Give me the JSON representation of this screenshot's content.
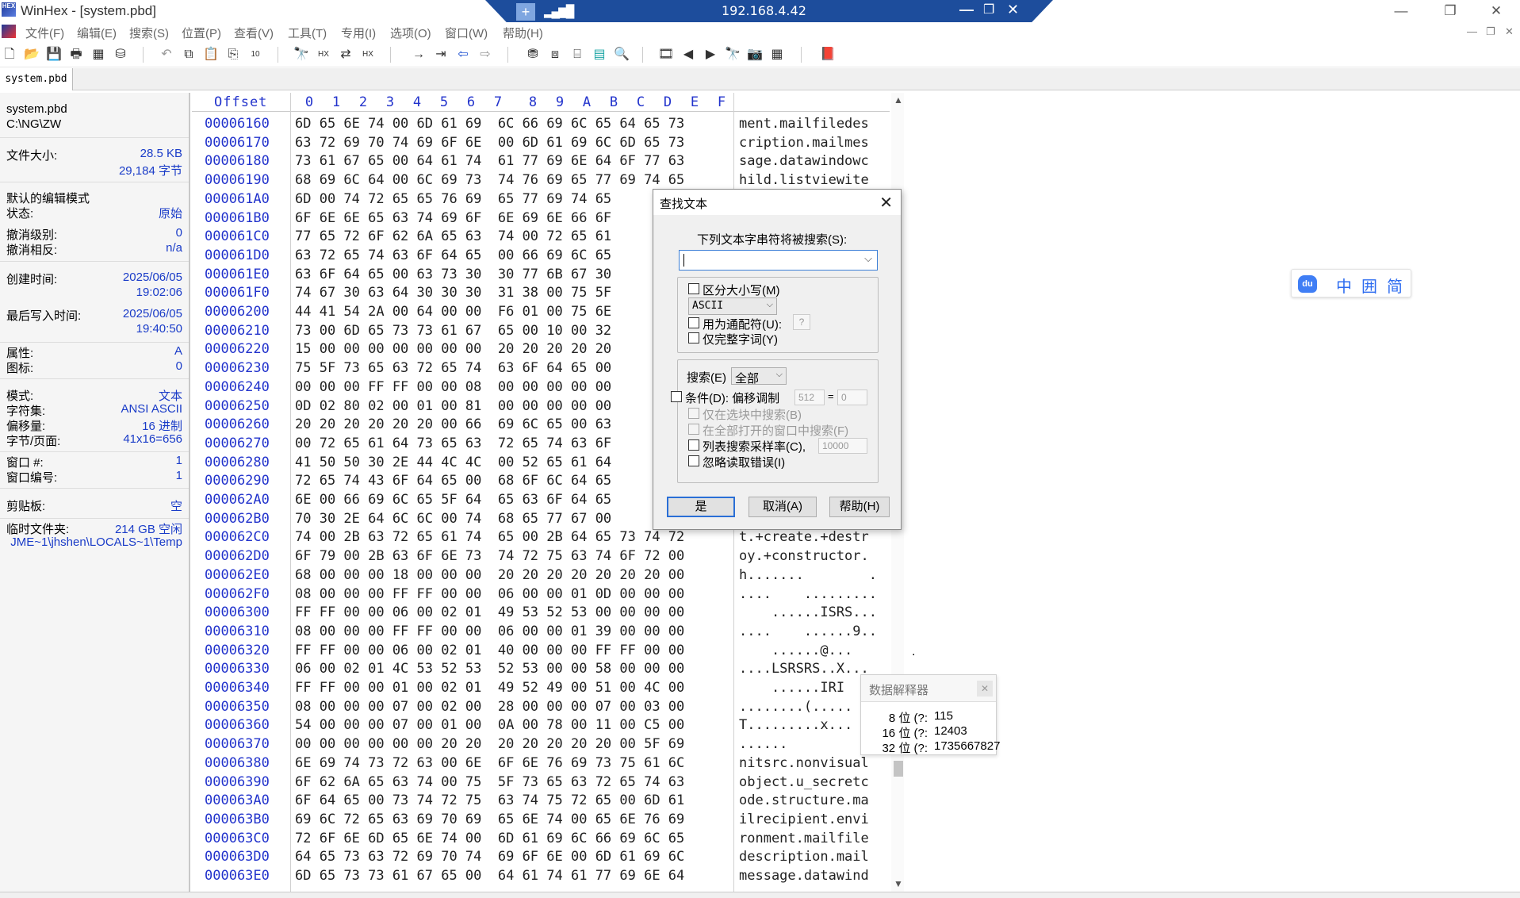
{
  "window": {
    "title": "WinHex - [system.pbd]"
  },
  "remote_bar": {
    "ip": "192.168.4.42"
  },
  "menu": {
    "items": [
      "文件(F)",
      "编辑(E)",
      "搜索(S)",
      "位置(P)",
      "查看(V)",
      "工具(T)",
      "专用(I)",
      "选项(O)",
      "窗口(W)",
      "帮助(H)"
    ]
  },
  "tab": {
    "name": "system.pbd"
  },
  "info": {
    "file_name": "system.pbd",
    "path": "C:\\NG\\ZW",
    "size_label": "文件大小:",
    "size_kb": "28.5 KB",
    "size_bytes": "29,184 字节",
    "edit_mode_label": "默认的编辑模式",
    "state_label": "状态:",
    "state_value": "原始",
    "undo_level_label": "撤消级别:",
    "undo_level_value": "0",
    "undo_reverse_label": "撤消相反:",
    "undo_reverse_value": "n/a",
    "created_label": "创建时间:",
    "created_date": "2025/06/05",
    "created_time": "19:02:06",
    "modified_label": "最后写入时间:",
    "modified_date": "2025/06/05",
    "modified_time": "19:40:50",
    "attr_label": "属性:",
    "attr_value": "A",
    "icon_label": "图标:",
    "icon_value": "0",
    "mode_label": "模式:",
    "mode_value": "文本",
    "charset_label": "字符集:",
    "charset_value": "ANSI ASCII",
    "offset_label": "偏移量:",
    "offset_value": "16 进制",
    "bpp_label": "字节/页面:",
    "bpp_value": "41x16=656",
    "window_num_label": "窗口 #:",
    "window_num_value": "1",
    "window_id_label": "窗口编号:",
    "window_id_value": "1",
    "clipboard_label": "剪贴板:",
    "clipboard_value": "空",
    "temp_label": "临时文件夹:",
    "temp_free": "214 GB 空闲",
    "temp_path": "JME~1\\jhshen\\LOCALS~1\\Temp"
  },
  "hex": {
    "offset_header": "Offset",
    "columns": [
      "0",
      "1",
      "2",
      "3",
      "4",
      "5",
      "6",
      "7",
      "8",
      "9",
      "A",
      "B",
      "C",
      "D",
      "E",
      "F"
    ],
    "rows": [
      {
        "offset": "00006160",
        "bytes": "6D 65 6E 74 00 6D 61 69  6C 66 69 6C 65 64 65 73",
        "text": "ment.mailfiledes"
      },
      {
        "offset": "00006170",
        "bytes": "63 72 69 70 74 69 6F 6E  00 6D 61 69 6C 6D 65 73",
        "text": "cription.mailmes"
      },
      {
        "offset": "00006180",
        "bytes": "73 61 67 65 00 64 61 74  61 77 69 6E 64 6F 77 63",
        "text": "sage.datawindowc"
      },
      {
        "offset": "00006190",
        "bytes": "68 69 6C 64 00 6C 69 73  74 76 69 65 77 69 74 65",
        "text": "hild.listviewite"
      },
      {
        "offset": "000061A0",
        "bytes": "6D 00 74 72 65 65 76 69  65 77 69 74 65",
        "text": ""
      },
      {
        "offset": "000061B0",
        "bytes": "6F 6E 6E 65 63 74 69 6F  6E 69 6E 66 6F",
        "text": ""
      },
      {
        "offset": "000061C0",
        "bytes": "77 65 72 6F 62 6A 65 63  74 00 72 65 61",
        "text": ""
      },
      {
        "offset": "000061D0",
        "bytes": "63 72 65 74 63 6F 64 65  00 66 69 6C 65",
        "text": ""
      },
      {
        "offset": "000061E0",
        "bytes": "63 6F 64 65 00 63 73 30  30 77 6B 67 30",
        "text": ""
      },
      {
        "offset": "000061F0",
        "bytes": "74 67 30 63 64 30 30 30  31 38 00 75 5F",
        "text": ""
      },
      {
        "offset": "00006200",
        "bytes": "44 41 54 2A 00 64 00 00  F6 01 00 75 6E",
        "text": ""
      },
      {
        "offset": "00006210",
        "bytes": "73 00 6D 65 73 73 61 67  65 00 10 00 32",
        "text": ""
      },
      {
        "offset": "00006220",
        "bytes": "15 00 00 00 00 00 00 00  20 20 20 20 20",
        "text": ""
      },
      {
        "offset": "00006230",
        "bytes": "75 5F 73 65 63 72 65 74  63 6F 64 65 00",
        "text": ""
      },
      {
        "offset": "00006240",
        "bytes": "00 00 00 FF FF 00 00 08  00 00 00 00 00",
        "text": ""
      },
      {
        "offset": "00006250",
        "bytes": "0D 02 80 02 00 01 00 81  00 00 00 00 00",
        "text": ""
      },
      {
        "offset": "00006260",
        "bytes": "20 20 20 20 20 20 00 66  69 6C 65 00 63",
        "text": ""
      },
      {
        "offset": "00006270",
        "bytes": "00 72 65 61 64 73 65 63  72 65 74 63 6F",
        "text": ""
      },
      {
        "offset": "00006280",
        "bytes": "41 50 50 30 2E 44 4C 4C  00 52 65 61 64",
        "text": ""
      },
      {
        "offset": "00006290",
        "bytes": "72 65 74 43 6F 64 65 00  68 6F 6C 64 65",
        "text": ""
      },
      {
        "offset": "000062A0",
        "bytes": "6E 00 66 69 6C 65 5F 64  65 63 6F 64 65",
        "text": ""
      },
      {
        "offset": "000062B0",
        "bytes": "70 30 2E 64 6C 6C 00 74  68 65 77 67 00",
        "text": ""
      },
      {
        "offset": "000062C0",
        "bytes": "74 00 2B 63 72 65 61 74  65 00 2B 64 65 73 74 72",
        "text": "t.+create.+destr"
      },
      {
        "offset": "000062D0",
        "bytes": "6F 79 00 2B 63 6F 6E 73  74 72 75 63 74 6F 72 00",
        "text": "oy.+constructor."
      },
      {
        "offset": "000062E0",
        "bytes": "68 00 00 00 18 00 00 00  20 20 20 20 20 20 20 00",
        "text": "h.......        ."
      },
      {
        "offset": "000062F0",
        "bytes": "08 00 00 00 FF FF 00 00  06 00 00 01 0D 00 00 00",
        "text": "....    ........."
      },
      {
        "offset": "00006300",
        "bytes": "FF FF 00 00 06 00 02 01  49 53 52 53 00 00 00 00",
        "text": "    ......ISRS..."
      },
      {
        "offset": "00006310",
        "bytes": "08 00 00 00 FF FF 00 00  06 00 00 01 39 00 00 00",
        "text": "....    ......9.."
      },
      {
        "offset": "00006320",
        "bytes": "FF FF 00 00 06 00 02 01  40 00 00 00 FF FF 00 00",
        "text": "    ......@..."
      },
      {
        "offset": "00006330",
        "bytes": "06 00 02 01 4C 53 52 53  52 53 00 00 58 00 00 00",
        "text": "....LSRSRS..X..."
      },
      {
        "offset": "00006340",
        "bytes": "FF FF 00 00 01 00 02 01  49 52 49 00 51 00 4C 00",
        "text": "    ......IRI"
      },
      {
        "offset": "00006350",
        "bytes": "08 00 00 00 07 00 02 00  28 00 00 00 07 00 03 00",
        "text": "........(....."
      },
      {
        "offset": "00006360",
        "bytes": "54 00 00 00 07 00 01 00  0A 00 78 00 11 00 C5 00",
        "text": "T.........x..."
      },
      {
        "offset": "00006370",
        "bytes": "00 00 00 00 00 00 20 20  20 20 20 20 20 00 5F 69",
        "text": "......"
      },
      {
        "offset": "00006380",
        "bytes": "6E 69 74 73 72 63 00 6E  6F 6E 76 69 73 75 61 6C",
        "text": "nitsrc.nonvisual"
      },
      {
        "offset": "00006390",
        "bytes": "6F 62 6A 65 63 74 00 75  5F 73 65 63 72 65 74 63",
        "text": "object.u_secretc"
      },
      {
        "offset": "000063A0",
        "bytes": "6F 64 65 00 73 74 72 75  63 74 75 72 65 00 6D 61",
        "text": "ode.structure.ma"
      },
      {
        "offset": "000063B0",
        "bytes": "69 6C 72 65 63 69 70 69  65 6E 74 00 65 6E 76 69",
        "text": "ilrecipient.envi"
      },
      {
        "offset": "000063C0",
        "bytes": "72 6F 6E 6D 65 6E 74 00  6D 61 69 6C 66 69 6C 65",
        "text": "ronment.mailfile"
      },
      {
        "offset": "000063D0",
        "bytes": "64 65 73 63 72 69 70 74  69 6F 6E 00 6D 61 69 6C",
        "text": "description.mail"
      },
      {
        "offset": "000063E0",
        "bytes": "6D 65 73 73 61 67 65 00  64 61 74 61 77 69 6E 64",
        "text": "message.datawind"
      }
    ]
  },
  "find_dialog": {
    "title": "查找文本",
    "prompt": "下列文本字串符将被搜索(S):",
    "search_value": "",
    "case_label": "区分大小写(M)",
    "encoding_value": "ASCII",
    "wildcard_label": "用为通配符(U):",
    "wildcard_char": "?",
    "whole_word_label": "仅完整字词(Y)",
    "search_dir_label": "搜索(E)",
    "search_dir_value": "全部",
    "cond_label": "条件(D): 偏移调制",
    "cond_mod": "512",
    "cond_eq": "=",
    "cond_rem": "0",
    "in_block_label": "仅在选块中搜索(B)",
    "all_windows_label": "在全部打开的窗口中搜索(F)",
    "list_sample_label": "列表搜索采样率(C),",
    "list_sample_value": "10000",
    "ignore_errors_label": "忽略读取错误(I)",
    "ok_label": "是",
    "cancel_label": "取消(A)",
    "help_label": "帮助(H)"
  },
  "data_interpreter": {
    "title": "数据解释器",
    "rows": [
      {
        "label": "8 位 (?:",
        "value": "115"
      },
      {
        "label": "16 位 (?:",
        "value": "12403"
      },
      {
        "label": "32 位 (?:",
        "value": "1735667827"
      }
    ]
  },
  "ime": {
    "chars": [
      "中",
      "囲",
      "简"
    ]
  }
}
